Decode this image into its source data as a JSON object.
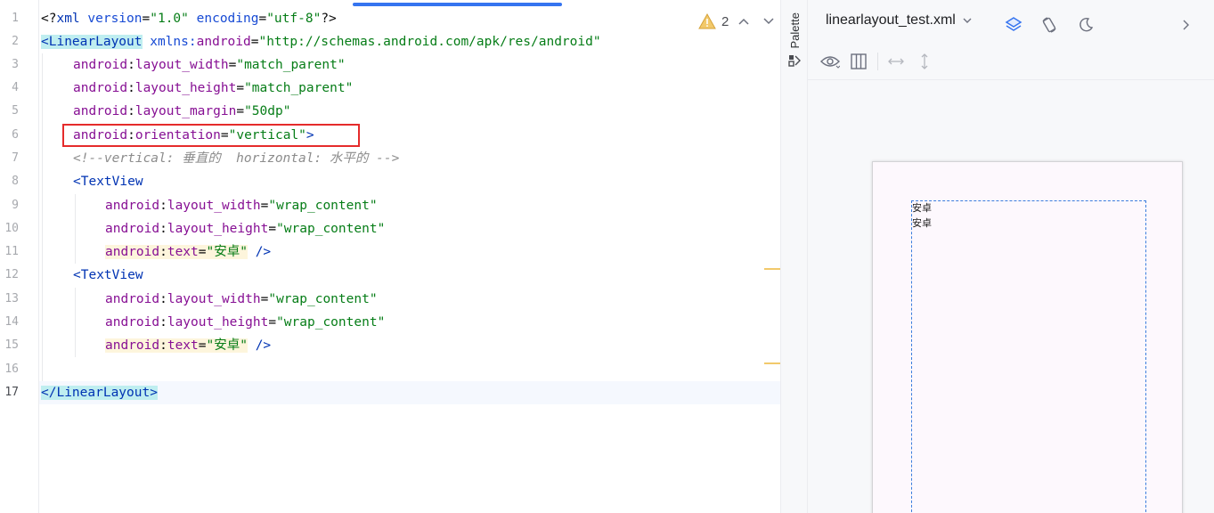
{
  "editor": {
    "inspections": {
      "warning_count": "2"
    },
    "line_numbers": [
      "1",
      "2",
      "3",
      "4",
      "5",
      "6",
      "7",
      "8",
      "9",
      "10",
      "11",
      "12",
      "13",
      "14",
      "15",
      "16",
      "17"
    ],
    "code": {
      "l1": {
        "a": "<?",
        "b": "xml ",
        "c": "version",
        "d": "=",
        "e": "\"1.0\"",
        "f": " ",
        "g": "encoding",
        "h": "=",
        "i": "\"utf-8\"",
        "j": "?>"
      },
      "l2": {
        "a": "<LinearLayout",
        "b": " ",
        "c": "xmlns:",
        "d": "android",
        "e": "=",
        "f": "\"http://schemas.android.com/apk/res/android\""
      },
      "l3": {
        "ns": "android",
        "colon": ":",
        "attr": "layout_width",
        "eq": "=",
        "val": "\"match_parent\""
      },
      "l4": {
        "ns": "android",
        "colon": ":",
        "attr": "layout_height",
        "eq": "=",
        "val": "\"match_parent\""
      },
      "l5": {
        "ns": "android",
        "colon": ":",
        "attr": "layout_margin",
        "eq": "=",
        "val": "\"50dp\""
      },
      "l6": {
        "ns": "android",
        "colon": ":",
        "attr": "orientation",
        "eq": "=",
        "val": "\"vertical\"",
        "close": ">"
      },
      "l7": {
        "comment": "<!--vertical: 垂直的  horizontal: 水平的 -->"
      },
      "l8": {
        "lt": "<",
        "tag": "TextView"
      },
      "l9": {
        "ns": "android",
        "colon": ":",
        "attr": "layout_width",
        "eq": "=",
        "val": "\"wrap_content\""
      },
      "l10": {
        "ns": "android",
        "colon": ":",
        "attr": "layout_height",
        "eq": "=",
        "val": "\"wrap_content\""
      },
      "l11": {
        "ns": "android",
        "colon": ":",
        "attr": "text",
        "eq": "=",
        "val": "\"安卓\"",
        "close": " />"
      },
      "l12": {
        "lt": "<",
        "tag": "TextView"
      },
      "l13": {
        "ns": "android",
        "colon": ":",
        "attr": "layout_width",
        "eq": "=",
        "val": "\"wrap_content\""
      },
      "l14": {
        "ns": "android",
        "colon": ":",
        "attr": "layout_height",
        "eq": "=",
        "val": "\"wrap_content\""
      },
      "l15": {
        "ns": "android",
        "colon": ":",
        "attr": "text",
        "eq": "=",
        "val": "\"安卓\"",
        "close": " />"
      },
      "l17": {
        "a": "</LinearLayout",
        "b": ">"
      }
    }
  },
  "palette": {
    "label": "Palette",
    "icon": "palette-icon"
  },
  "design": {
    "file_name": "linearlayout_test.xml",
    "toolbar_icons": [
      "chevron-down-icon",
      "layers-icon",
      "rotate-device-icon",
      "night-mode-icon",
      "chevron-right-icon"
    ],
    "sub_toolbar_icons": [
      "eye-icon",
      "columns-icon",
      "horizontal-resize-icon",
      "vertical-resize-icon"
    ],
    "preview": {
      "items": [
        "安卓",
        "安卓"
      ]
    }
  },
  "colors": {
    "accent": "#3574f0",
    "highlight_box": "#e52b2b",
    "warning": "#f2c96b"
  }
}
